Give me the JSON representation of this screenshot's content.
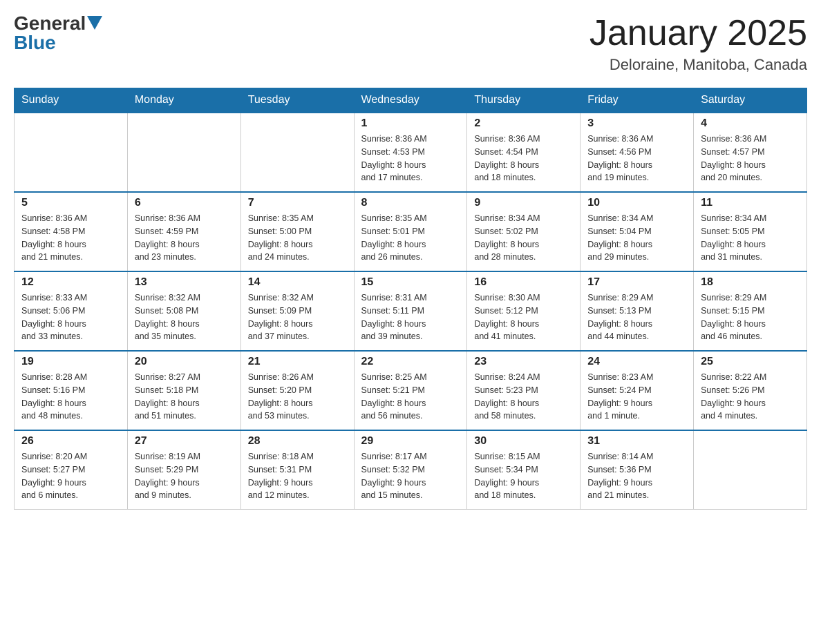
{
  "header": {
    "logo_general": "General",
    "logo_blue": "Blue",
    "month_title": "January 2025",
    "location": "Deloraine, Manitoba, Canada"
  },
  "days_of_week": [
    "Sunday",
    "Monday",
    "Tuesday",
    "Wednesday",
    "Thursday",
    "Friday",
    "Saturday"
  ],
  "weeks": [
    [
      {
        "day": "",
        "info": ""
      },
      {
        "day": "",
        "info": ""
      },
      {
        "day": "",
        "info": ""
      },
      {
        "day": "1",
        "info": "Sunrise: 8:36 AM\nSunset: 4:53 PM\nDaylight: 8 hours\nand 17 minutes."
      },
      {
        "day": "2",
        "info": "Sunrise: 8:36 AM\nSunset: 4:54 PM\nDaylight: 8 hours\nand 18 minutes."
      },
      {
        "day": "3",
        "info": "Sunrise: 8:36 AM\nSunset: 4:56 PM\nDaylight: 8 hours\nand 19 minutes."
      },
      {
        "day": "4",
        "info": "Sunrise: 8:36 AM\nSunset: 4:57 PM\nDaylight: 8 hours\nand 20 minutes."
      }
    ],
    [
      {
        "day": "5",
        "info": "Sunrise: 8:36 AM\nSunset: 4:58 PM\nDaylight: 8 hours\nand 21 minutes."
      },
      {
        "day": "6",
        "info": "Sunrise: 8:36 AM\nSunset: 4:59 PM\nDaylight: 8 hours\nand 23 minutes."
      },
      {
        "day": "7",
        "info": "Sunrise: 8:35 AM\nSunset: 5:00 PM\nDaylight: 8 hours\nand 24 minutes."
      },
      {
        "day": "8",
        "info": "Sunrise: 8:35 AM\nSunset: 5:01 PM\nDaylight: 8 hours\nand 26 minutes."
      },
      {
        "day": "9",
        "info": "Sunrise: 8:34 AM\nSunset: 5:02 PM\nDaylight: 8 hours\nand 28 minutes."
      },
      {
        "day": "10",
        "info": "Sunrise: 8:34 AM\nSunset: 5:04 PM\nDaylight: 8 hours\nand 29 minutes."
      },
      {
        "day": "11",
        "info": "Sunrise: 8:34 AM\nSunset: 5:05 PM\nDaylight: 8 hours\nand 31 minutes."
      }
    ],
    [
      {
        "day": "12",
        "info": "Sunrise: 8:33 AM\nSunset: 5:06 PM\nDaylight: 8 hours\nand 33 minutes."
      },
      {
        "day": "13",
        "info": "Sunrise: 8:32 AM\nSunset: 5:08 PM\nDaylight: 8 hours\nand 35 minutes."
      },
      {
        "day": "14",
        "info": "Sunrise: 8:32 AM\nSunset: 5:09 PM\nDaylight: 8 hours\nand 37 minutes."
      },
      {
        "day": "15",
        "info": "Sunrise: 8:31 AM\nSunset: 5:11 PM\nDaylight: 8 hours\nand 39 minutes."
      },
      {
        "day": "16",
        "info": "Sunrise: 8:30 AM\nSunset: 5:12 PM\nDaylight: 8 hours\nand 41 minutes."
      },
      {
        "day": "17",
        "info": "Sunrise: 8:29 AM\nSunset: 5:13 PM\nDaylight: 8 hours\nand 44 minutes."
      },
      {
        "day": "18",
        "info": "Sunrise: 8:29 AM\nSunset: 5:15 PM\nDaylight: 8 hours\nand 46 minutes."
      }
    ],
    [
      {
        "day": "19",
        "info": "Sunrise: 8:28 AM\nSunset: 5:16 PM\nDaylight: 8 hours\nand 48 minutes."
      },
      {
        "day": "20",
        "info": "Sunrise: 8:27 AM\nSunset: 5:18 PM\nDaylight: 8 hours\nand 51 minutes."
      },
      {
        "day": "21",
        "info": "Sunrise: 8:26 AM\nSunset: 5:20 PM\nDaylight: 8 hours\nand 53 minutes."
      },
      {
        "day": "22",
        "info": "Sunrise: 8:25 AM\nSunset: 5:21 PM\nDaylight: 8 hours\nand 56 minutes."
      },
      {
        "day": "23",
        "info": "Sunrise: 8:24 AM\nSunset: 5:23 PM\nDaylight: 8 hours\nand 58 minutes."
      },
      {
        "day": "24",
        "info": "Sunrise: 8:23 AM\nSunset: 5:24 PM\nDaylight: 9 hours\nand 1 minute."
      },
      {
        "day": "25",
        "info": "Sunrise: 8:22 AM\nSunset: 5:26 PM\nDaylight: 9 hours\nand 4 minutes."
      }
    ],
    [
      {
        "day": "26",
        "info": "Sunrise: 8:20 AM\nSunset: 5:27 PM\nDaylight: 9 hours\nand 6 minutes."
      },
      {
        "day": "27",
        "info": "Sunrise: 8:19 AM\nSunset: 5:29 PM\nDaylight: 9 hours\nand 9 minutes."
      },
      {
        "day": "28",
        "info": "Sunrise: 8:18 AM\nSunset: 5:31 PM\nDaylight: 9 hours\nand 12 minutes."
      },
      {
        "day": "29",
        "info": "Sunrise: 8:17 AM\nSunset: 5:32 PM\nDaylight: 9 hours\nand 15 minutes."
      },
      {
        "day": "30",
        "info": "Sunrise: 8:15 AM\nSunset: 5:34 PM\nDaylight: 9 hours\nand 18 minutes."
      },
      {
        "day": "31",
        "info": "Sunrise: 8:14 AM\nSunset: 5:36 PM\nDaylight: 9 hours\nand 21 minutes."
      },
      {
        "day": "",
        "info": ""
      }
    ]
  ]
}
